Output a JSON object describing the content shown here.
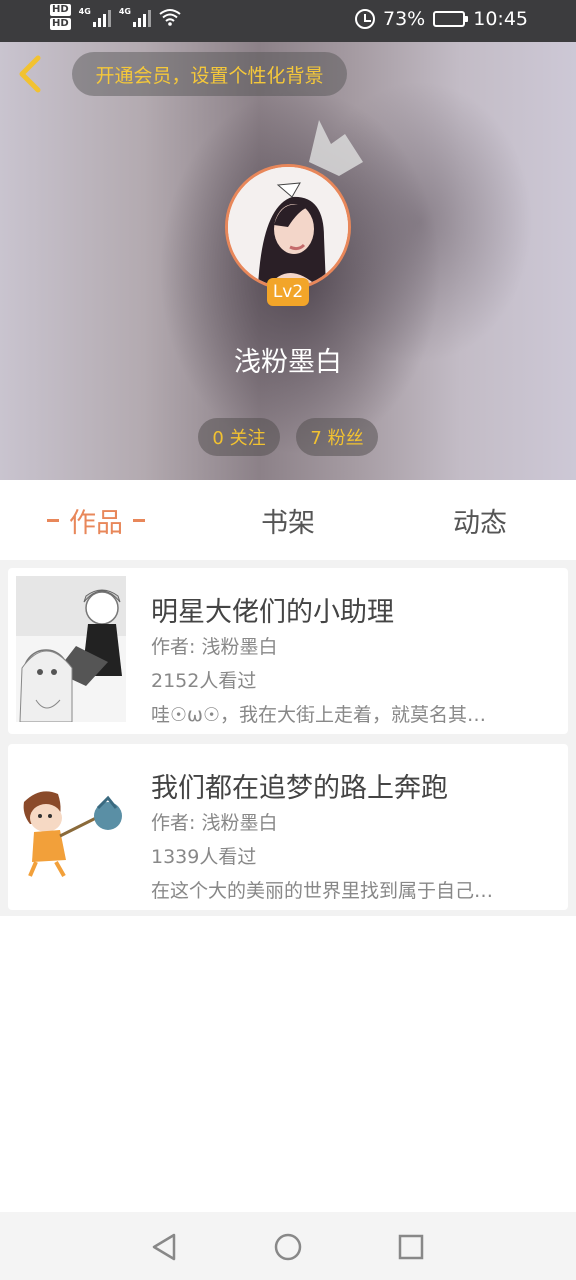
{
  "status_bar": {
    "network_labels": [
      "HD",
      "HD"
    ],
    "signal_labels": [
      "4G",
      "4G"
    ],
    "battery": "73%",
    "battery_level": 0.73,
    "time": "10:45"
  },
  "header": {
    "vip_text": "开通会员，设置个性化背景",
    "level": "Lv2",
    "username": "浅粉墨白",
    "follow_text": "0 关注",
    "fans_text": "7 粉丝"
  },
  "tabs": [
    {
      "label": "作品",
      "active": true
    },
    {
      "label": "书架",
      "active": false
    },
    {
      "label": "动态",
      "active": false
    }
  ],
  "works": [
    {
      "title": "明星大佬们的小助理",
      "author": "作者: 浅粉墨白",
      "views": "2152人看过",
      "desc": "哇☉ω☉，我在大街上走着，就莫名其…"
    },
    {
      "title": "我们都在追梦的路上奔跑",
      "author": "作者: 浅粉墨白",
      "views": "1339人看过",
      "desc": "在这个大的美丽的世界里找到属于自己…"
    }
  ],
  "colors": {
    "accent": "#e8875a",
    "gold": "#f2c230",
    "status_bar": "#3c3c3e"
  }
}
